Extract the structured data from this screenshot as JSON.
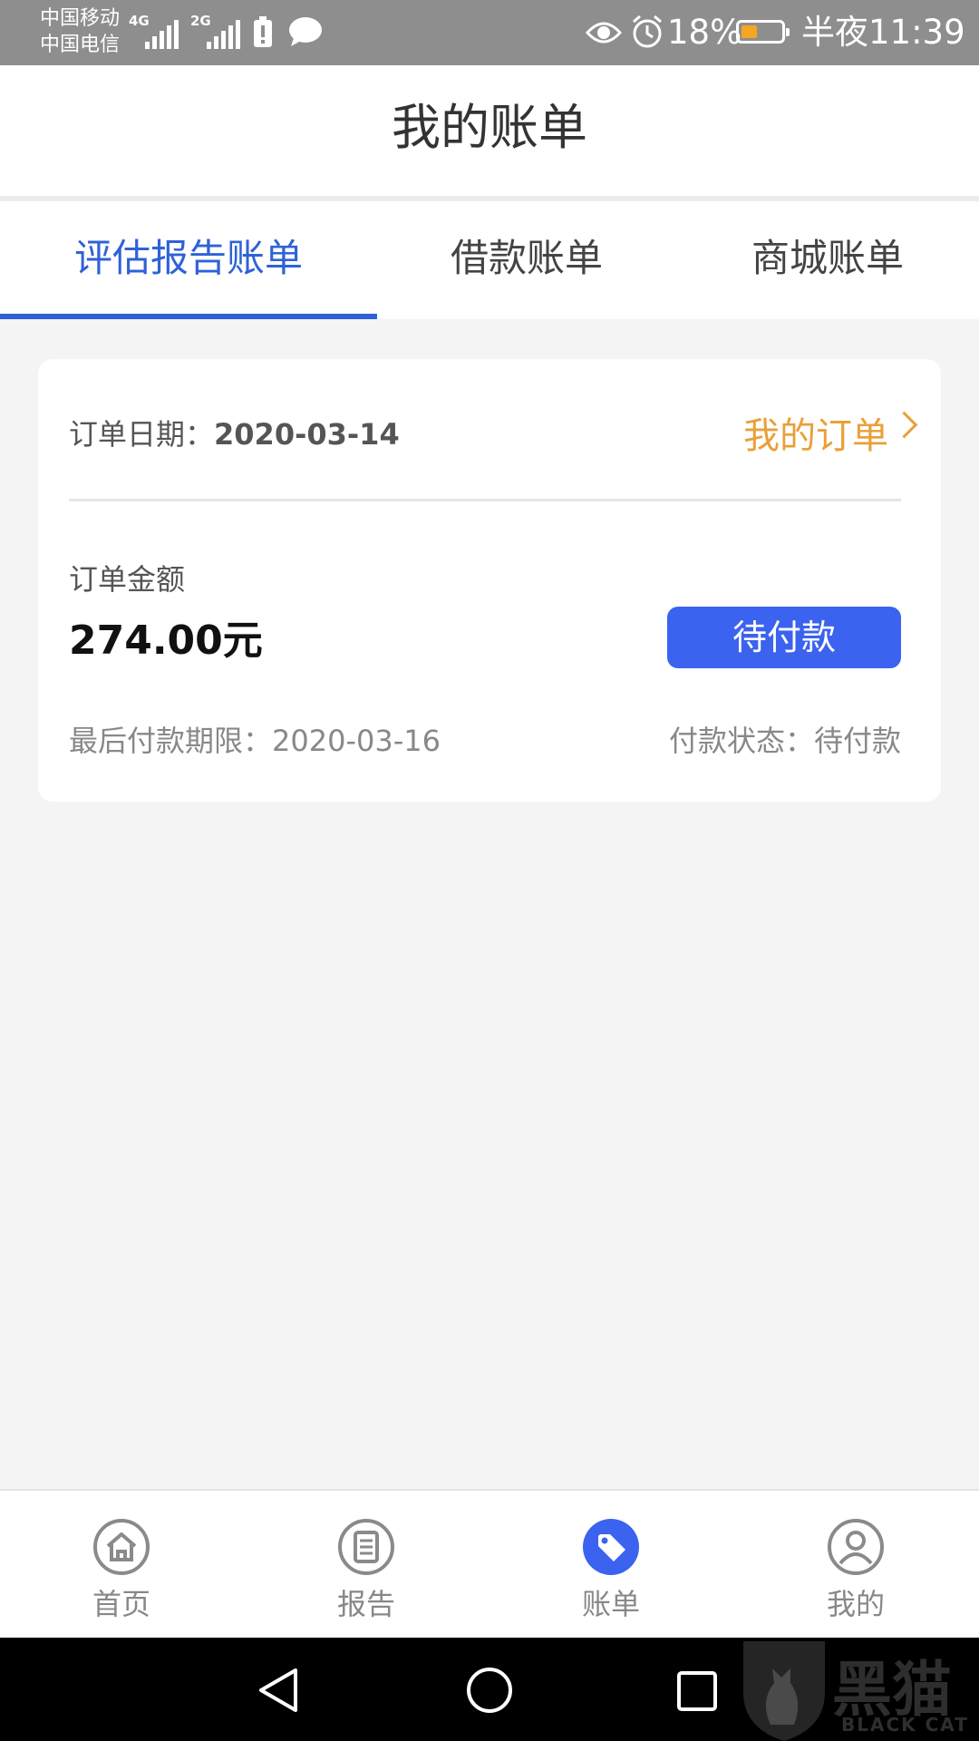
{
  "statusbar": {
    "carrier1": "中国移动",
    "carrier2": "中国电信",
    "net1": "4G",
    "net2": "2G",
    "battery_percent": "18%",
    "time": "半夜11:39",
    "battery_level": 0.18
  },
  "header": {
    "title": "我的账单"
  },
  "tabs": [
    {
      "label": "评估报告账单",
      "active": true
    },
    {
      "label": "借款账单",
      "active": false
    },
    {
      "label": "商城账单",
      "active": false
    }
  ],
  "card": {
    "order_date_label": "订单日期：",
    "order_date": "2020-03-14",
    "my_orders_link": "我的订单",
    "amount_label": "订单金额",
    "amount": "274.00元",
    "pay_button": "待付款",
    "deadline_label": "最后付款期限：",
    "deadline": "2020-03-16",
    "status_label": "付款状态：",
    "status": "待付款"
  },
  "bottom_nav": [
    {
      "label": "首页",
      "icon": "home-icon",
      "active": false
    },
    {
      "label": "报告",
      "icon": "report-icon",
      "active": false
    },
    {
      "label": "账单",
      "icon": "tag-icon",
      "active": true
    },
    {
      "label": "我的",
      "icon": "user-icon",
      "active": false
    }
  ],
  "watermark": {
    "text": "黑猫",
    "sub": "BLACK CAT"
  },
  "colors": {
    "accent": "#2f62d8",
    "button": "#3b63ef",
    "link": "#e9a039"
  }
}
